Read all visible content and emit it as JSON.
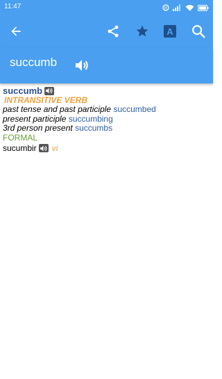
{
  "status": {
    "time": "11:47"
  },
  "app": {
    "word": "succumb"
  },
  "entry": {
    "headword": "succumb",
    "pos": "INTRANSITIVE VERB",
    "forms": [
      {
        "label": "past tense and past participle",
        "value": "succumbed"
      },
      {
        "label": "present participle",
        "value": "succumbing"
      },
      {
        "label": "3rd person present",
        "value": "succumbs"
      }
    ],
    "register": "FORMAL",
    "translation": {
      "word": "sucumbir",
      "pos": "vi"
    }
  },
  "colors": {
    "accent": "#4a9ff0",
    "headword": "#2f4f90",
    "pos": "#f0a040",
    "register": "#6a9e3a"
  }
}
